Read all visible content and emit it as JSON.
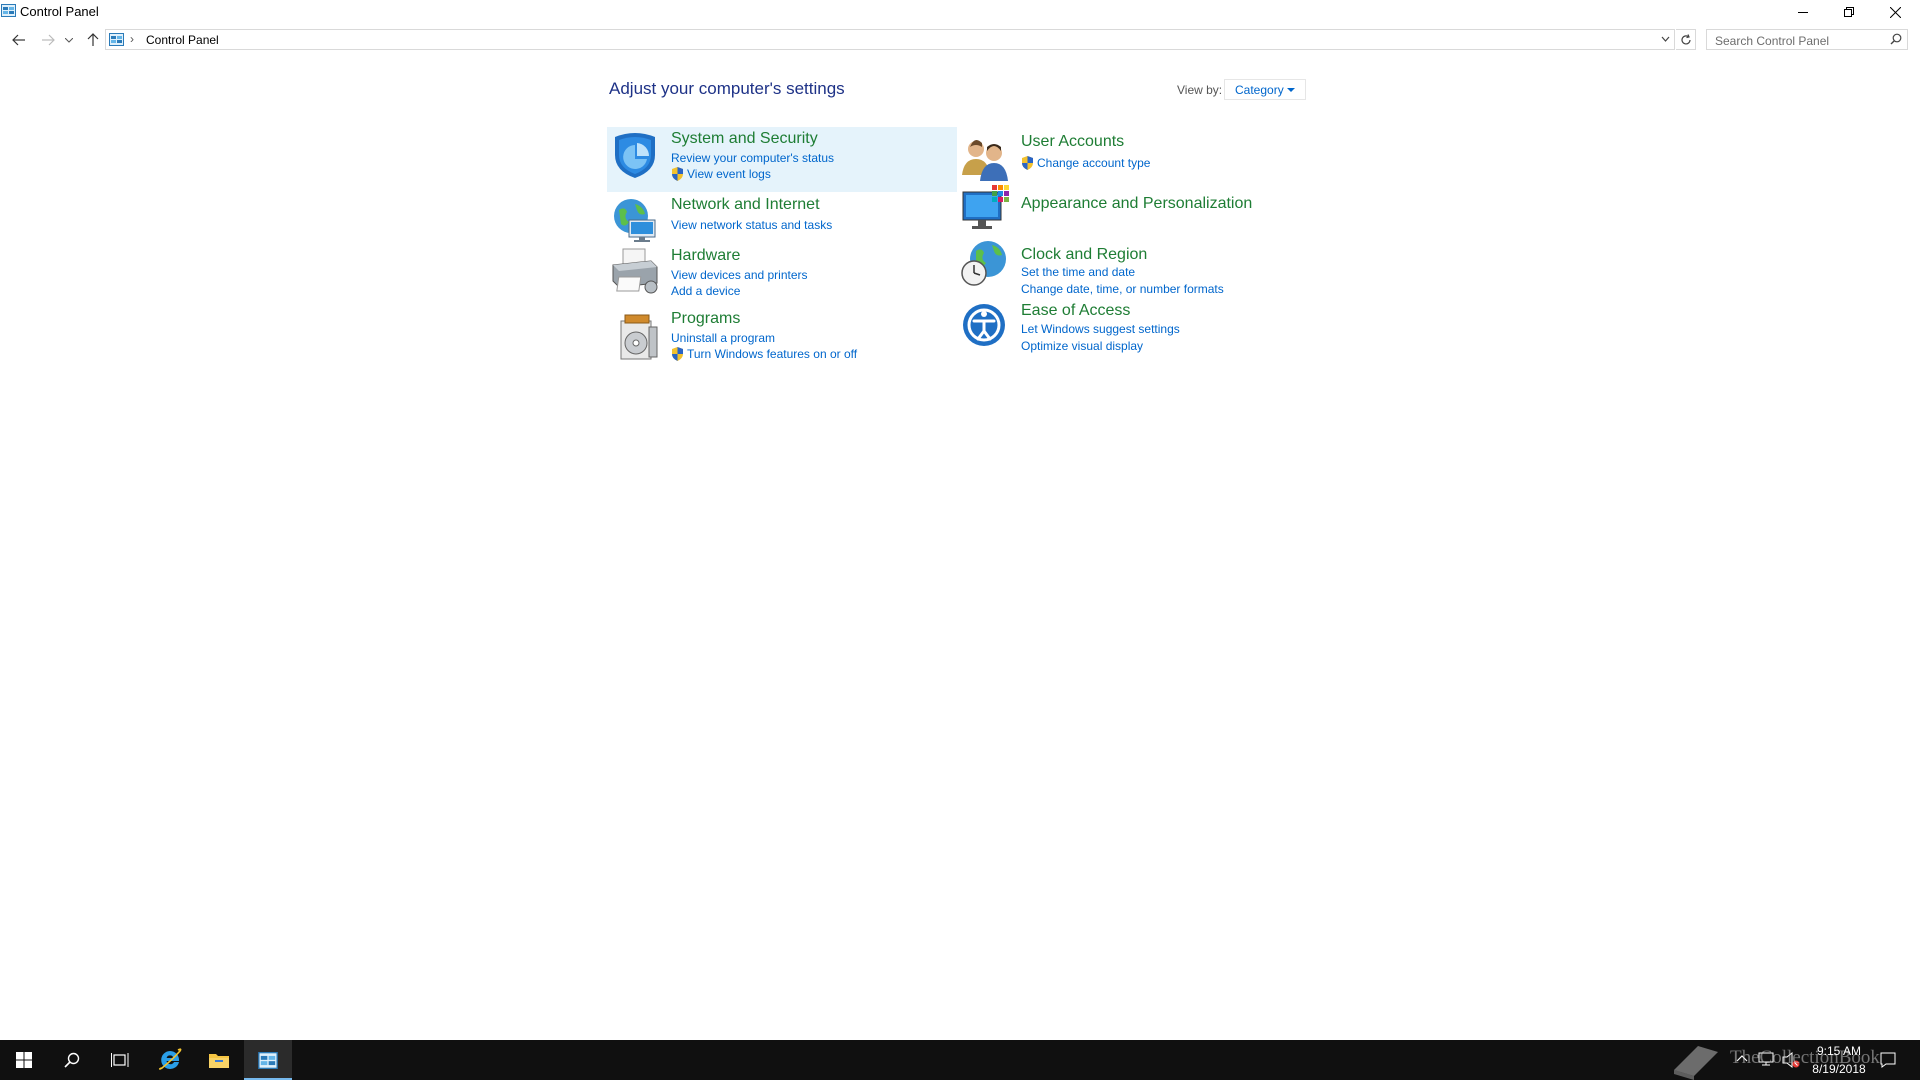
{
  "window": {
    "title": "Control Panel"
  },
  "address": {
    "breadcrumb": "Control Panel",
    "search_placeholder": "Search Control Panel"
  },
  "main": {
    "heading": "Adjust your computer's settings",
    "view_by_label": "View by:",
    "view_by_value": "Category",
    "categories_left": [
      {
        "title": "System and Security",
        "icon": "shield-icon",
        "links": [
          {
            "text": "Review your computer's status",
            "shield": false
          },
          {
            "text": "View event logs",
            "shield": true
          }
        ]
      },
      {
        "title": "Network and Internet",
        "icon": "network-globe-icon",
        "links": [
          {
            "text": "View network status and tasks",
            "shield": false
          }
        ]
      },
      {
        "title": "Hardware",
        "icon": "printer-icon",
        "links": [
          {
            "text": "View devices and printers",
            "shield": false
          },
          {
            "text": "Add a device",
            "shield": false
          }
        ]
      },
      {
        "title": "Programs",
        "icon": "programs-disc-icon",
        "links": [
          {
            "text": "Uninstall a program",
            "shield": false
          },
          {
            "text": "Turn Windows features on or off",
            "shield": true
          }
        ]
      }
    ],
    "categories_right": [
      {
        "title": "User Accounts",
        "icon": "users-icon",
        "links": [
          {
            "text": "Change account type",
            "shield": true
          }
        ]
      },
      {
        "title": "Appearance and Personalization",
        "icon": "monitor-palette-icon",
        "links": []
      },
      {
        "title": "Clock and Region",
        "icon": "clock-globe-icon",
        "links": [
          {
            "text": "Set the time and date",
            "shield": false
          },
          {
            "text": "Change date, time, or number formats",
            "shield": false
          }
        ]
      },
      {
        "title": "Ease of Access",
        "icon": "ease-of-access-icon",
        "links": [
          {
            "text": "Let Windows suggest settings",
            "shield": false
          },
          {
            "text": "Optimize visual display",
            "shield": false
          }
        ]
      }
    ]
  },
  "taskbar": {
    "time": "9:15 AM",
    "date": "8/19/2018",
    "watermark": "TheCollectionBook"
  },
  "colors": {
    "heading": "#1e3287",
    "category_title": "#1e7d34",
    "link": "#0066cc",
    "highlight": "#e5f3fb",
    "taskbar": "#101010"
  }
}
